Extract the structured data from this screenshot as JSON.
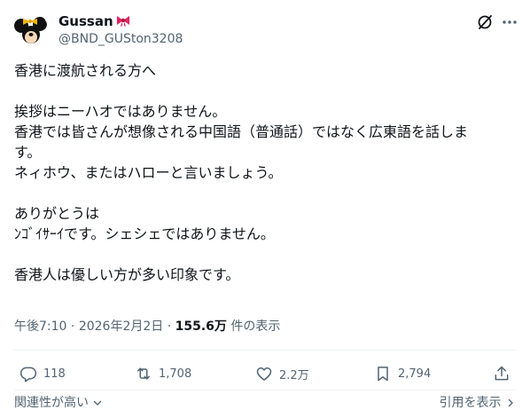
{
  "user": {
    "name": "Gussan",
    "handle": "@BND_GUSton3208"
  },
  "tweet": {
    "lines": [
      "香港に渡航される方へ",
      "",
      "挨拶はニーハオではありません。",
      "香港では皆さんが想像される中国語（普通話）ではなく広東語を話しま",
      "す。",
      "ネィホウ、またはハローと言いましょう。",
      "",
      "ありがとうは",
      "ﾝｺﾞｲｻｰｲです。シェシェではありません。",
      "",
      "香港人は優しい方が多い印象です。"
    ]
  },
  "meta": {
    "time": "午後7:10",
    "sep1": " · ",
    "date": "2026年2月2日",
    "sep2": " · ",
    "views": "155.6万",
    "views_suffix": " 件の表示"
  },
  "actions": {
    "replies": "118",
    "reposts": "1,708",
    "likes": "2.2万",
    "bookmarks": "2,794"
  },
  "footer": {
    "sort_label": "関連性が高い",
    "quotes_label": "引用を表示"
  },
  "colors": {
    "text": "#0f1419",
    "secondary": "#536471",
    "divider": "#eff3f4"
  }
}
